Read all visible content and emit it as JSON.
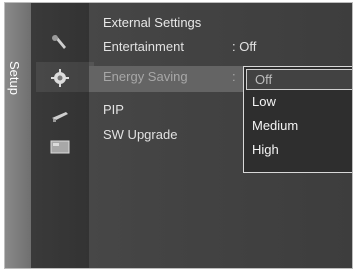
{
  "side_tab": {
    "label": "Setup"
  },
  "icons": [
    {
      "name": "satellite-dish-icon"
    },
    {
      "name": "gear-icon"
    },
    {
      "name": "antenna-icon"
    },
    {
      "name": "window-icon"
    }
  ],
  "menu": {
    "header": "External Settings",
    "rows": [
      {
        "label": "Entertainment",
        "value": ": Off"
      },
      {
        "label": "Energy Saving",
        "value": ":"
      },
      {
        "label": "PIP",
        "value": ""
      },
      {
        "label": "SW Upgrade",
        "value": ""
      }
    ]
  },
  "dropdown": {
    "options": [
      "Off",
      "Low",
      "Medium",
      "High"
    ],
    "selected": "Off"
  }
}
